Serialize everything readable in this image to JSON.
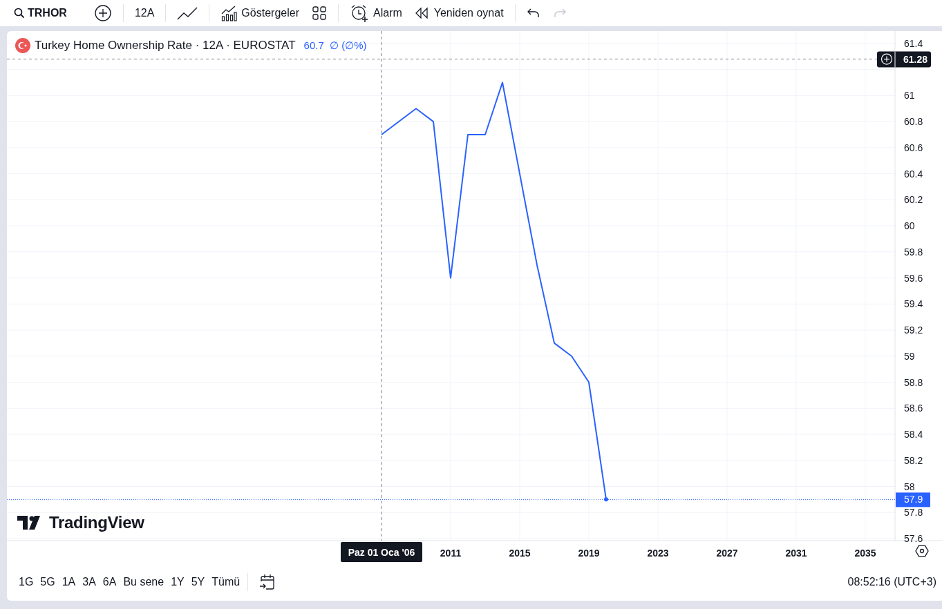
{
  "toolbar": {
    "symbol": "TRHOR",
    "interval": "12A",
    "indicators_label": "Göstergeler",
    "alarm_label": "Alarm",
    "replay_label": "Yeniden oynat",
    "undo_disabled": false,
    "redo_disabled": true
  },
  "legend": {
    "details": "· 12A · EUROSTAT",
    "value": "60.7  ∅ (∅%)"
  },
  "chart": {
    "chart_data": {
      "type": "line",
      "x": [
        2007,
        2009,
        2010,
        2011,
        2012,
        2013,
        2014,
        2016,
        2017,
        2018,
        2019,
        2020
      ],
      "series": [
        {
          "name": "Turkey Home Ownership Rate",
          "color": "#2962ff",
          "values": [
            60.7,
            60.9,
            60.8,
            59.6,
            60.7,
            60.7,
            61.1,
            59.7,
            59.1,
            59.0,
            58.8,
            57.9
          ]
        }
      ],
      "xlim": [
        1985.32,
        2039.44
      ],
      "ylim": [
        57.584,
        61.495
      ],
      "xticks": [
        2011,
        2015,
        2019,
        2023,
        2027,
        2031,
        2035
      ],
      "yticks": [
        57.6,
        57.8,
        58,
        58.2,
        58.4,
        58.6,
        58.8,
        59,
        59.2,
        59.4,
        59.6,
        59.8,
        60,
        60.2,
        60.4,
        60.6,
        60.8,
        61,
        61.4
      ],
      "grid": true,
      "ref_lines": [
        {
          "axis": "x",
          "value": 2007,
          "color": "#787b86"
        },
        {
          "axis": "y",
          "value": 61.28,
          "color": "#787b86"
        },
        {
          "axis": "y",
          "value": 57.9,
          "color": "#2962ff"
        }
      ]
    },
    "crosshair_price": "61.28",
    "crosshair_date": "Paz 01 Oca '06",
    "last_price": "57.9"
  },
  "logo": "TradingView",
  "ranges": [
    {
      "label": "1G"
    },
    {
      "label": "5G"
    },
    {
      "label": "1A"
    },
    {
      "label": "3A"
    },
    {
      "label": "6A"
    },
    {
      "label": "Bu sene"
    },
    {
      "label": "1Y"
    },
    {
      "label": "5Y"
    },
    {
      "label": "Tümü"
    }
  ],
  "clock": "08:52:16 (UTC+3)"
}
